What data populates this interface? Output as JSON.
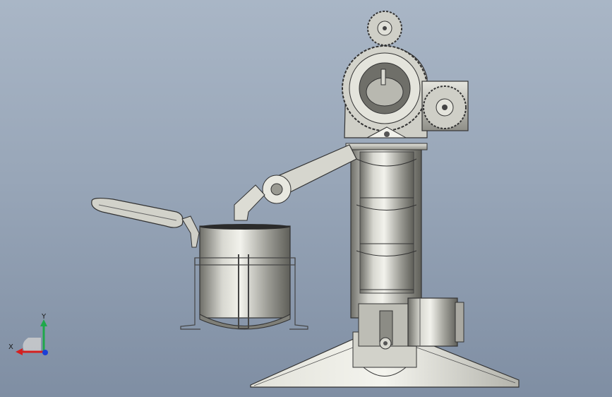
{
  "viewport": {
    "background_top": "#a9b6c6",
    "background_bottom": "#7f8ea3"
  },
  "triad": {
    "x_label": "X",
    "y_label": "Y",
    "x_color": "#d42020",
    "y_color": "#1fa84a",
    "z_color": "#1b3fd6"
  },
  "model": {
    "metal_color": "#c9c9c2",
    "shadow_color": "#6b6b66",
    "icons": [
      "gear-icon",
      "pot-icon",
      "lid-icon",
      "lever-arm-icon",
      "base-icon",
      "motor-icon",
      "view-triad-icon"
    ]
  }
}
